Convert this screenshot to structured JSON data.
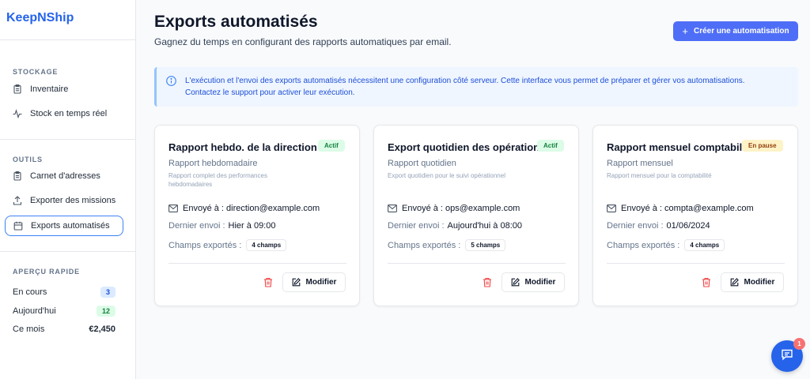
{
  "sidebar": {
    "logo": "KeepNShip",
    "sections": {
      "storage": "STOCKAGE",
      "tools": "OUTILS",
      "quick": "APERÇU RAPIDE"
    },
    "items": {
      "inventory": "Inventaire",
      "realtime": "Stock en temps réel",
      "addressbook": "Carnet d'adresses",
      "export_missions": "Exporter des missions",
      "auto_exports": "Exports automatisés"
    },
    "quick": [
      {
        "label": "En cours",
        "value": "3",
        "color": "#dbeafe",
        "text_color": "#1d4ed8"
      },
      {
        "label": "Aujourd'hui",
        "value": "12",
        "color": "#dcfce7",
        "text_color": "#15803d"
      },
      {
        "label": "Ce mois",
        "value": "€2,450"
      }
    ]
  },
  "header": {
    "title": "Exports automatisés",
    "subtitle": "Gagnez du temps en configurant des rapports automatiques par email.",
    "create_button": "Créer une automatisation"
  },
  "info": {
    "line1": "L'exécution et l'envoi des exports automatisés nécessitent une configuration côté serveur. Cette interface vous permet de préparer et gérer vos automatisations.",
    "line2": "Contactez le support pour activer leur exécution."
  },
  "cards": [
    {
      "title": "Rapport hebdo. de la direction",
      "status": "Actif",
      "frequency": "Rapport hebdomadaire",
      "description": "Rapport complet des performances hebdomadaires",
      "send_to": "Envoyé à : direction@example.com",
      "last_label": "Dernier envoi :",
      "last_value": "Hier à 09:00",
      "fields_label": "Champs exportés :",
      "fields_value": "4 champs",
      "modify": "Modifier"
    },
    {
      "title": "Export quotidien des opérations",
      "status": "Actif",
      "frequency": "Rapport quotidien",
      "description": "Export quotidien pour le suivi opérationnel",
      "send_to": "Envoyé à : ops@example.com",
      "last_label": "Dernier envoi :",
      "last_value": "Aujourd'hui à 08:00",
      "fields_label": "Champs exportés :",
      "fields_value": "5 champs",
      "modify": "Modifier"
    },
    {
      "title": "Rapport mensuel comptabilité",
      "status": "En pause",
      "frequency": "Rapport mensuel",
      "description": "Rapport mensuel pour la comptabilité",
      "send_to": "Envoyé à : compta@example.com",
      "last_label": "Dernier envoi :",
      "last_value": "01/06/2024",
      "fields_label": "Champs exportés :",
      "fields_value": "4 champs",
      "modify": "Modifier"
    }
  ],
  "chat": {
    "badge": "1"
  },
  "colors": {
    "accent": "#4f6ef7",
    "brand": "#2563eb",
    "active_status": "#dcfce7",
    "paused_status": "#fef3c7"
  }
}
